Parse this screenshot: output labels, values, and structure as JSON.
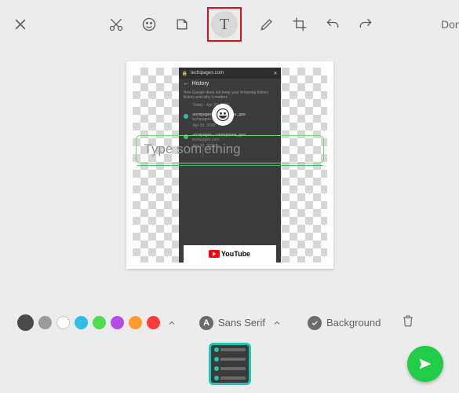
{
  "toolbar": {
    "done_label": "Done"
  },
  "text_input": {
    "placeholder_pre": "Type so",
    "placeholder_post": "ething"
  },
  "options": {
    "colors": [
      "#4a4a4a",
      "#9b9b9b",
      "#ffffff",
      "#2fbdea",
      "#4fdc4f",
      "#b44de6",
      "#ff9a2e",
      "#ff3b3b"
    ],
    "selected_color_index": 0,
    "font_label": "Sans Serif",
    "background_label": "Background"
  },
  "phone_preview": {
    "header": "techipages.com",
    "subheader": "History",
    "desc_line1": "How Google does not keep your browsing history",
    "desc_line2": "history and why it matters",
    "date_today": "Today - Apr 20, 2020",
    "item1_title": "Techipages - Smartphone, gad",
    "item1_sub": "techipages.com",
    "date_prev": "Apr 20, 2020",
    "item2_title": "Techipages - Smartphone, gad",
    "item2_sub": "techipages.com",
    "date_prev2": "Apr 20, 2020",
    "youtube_label": "YouTube"
  }
}
